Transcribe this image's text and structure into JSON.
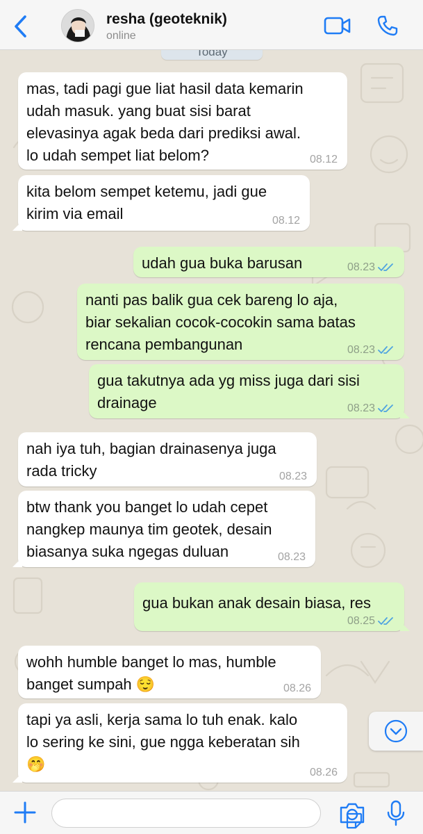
{
  "header": {
    "contact_name": "resha (geoteknik)",
    "status": "online",
    "back_icon": "chevron-left-icon",
    "video_icon": "video-camera-icon",
    "phone_icon": "phone-icon"
  },
  "chat": {
    "day_label": "Today",
    "messages": [
      {
        "dir": "in",
        "text": "mas, tadi pagi gue liat hasil data kemarin\nudah masuk. yang buat sisi barat\nelevasinya agak beda dari prediksi awal.\nlo udah sempet liat belom?",
        "time": "08.12"
      },
      {
        "dir": "in",
        "text": "kita belom sempet ketemu, jadi gue\nkirim via email",
        "time": "08.12"
      },
      {
        "dir": "out",
        "text": "udah gua buka barusan",
        "time": "08.23"
      },
      {
        "dir": "out",
        "text": "nanti pas balik gua cek bareng lo aja,\nbiar sekalian cocok-cocokin sama batas\nrencana pembangunan",
        "time": "08.23"
      },
      {
        "dir": "out",
        "text": "gua takutnya ada yg miss juga dari sisi\ndrainage",
        "time": "08.23"
      },
      {
        "dir": "in",
        "text": "nah iya tuh, bagian drainasenya juga\nrada tricky",
        "time": "08.23"
      },
      {
        "dir": "in",
        "text": "btw thank you banget lo udah cepet\nnangkep maunya tim geotek, desain\nbiasanya suka ngegas duluan",
        "time": "08.23"
      },
      {
        "dir": "out",
        "text": "gua bukan anak desain biasa, res",
        "time": "08.25"
      },
      {
        "dir": "in",
        "text": "wohh humble banget lo mas, humble\nbanget sumpah 😌",
        "time": "08.26"
      },
      {
        "dir": "in",
        "text": "tapi ya asli, kerja sama lo tuh enak. kalo\nlo sering ke sini, gue ngga keberatan sih\n🤭",
        "time": "08.26"
      }
    ],
    "colors": {
      "incoming": "#ffffff",
      "outgoing": "#dcf8c6",
      "read_ticks": "#4fa3e0",
      "accent": "#1f7cf5"
    }
  },
  "footer": {
    "attach_icon": "plus-icon",
    "sticker_icon": "sticker-icon",
    "camera_icon": "camera-icon",
    "mic_icon": "microphone-icon"
  }
}
